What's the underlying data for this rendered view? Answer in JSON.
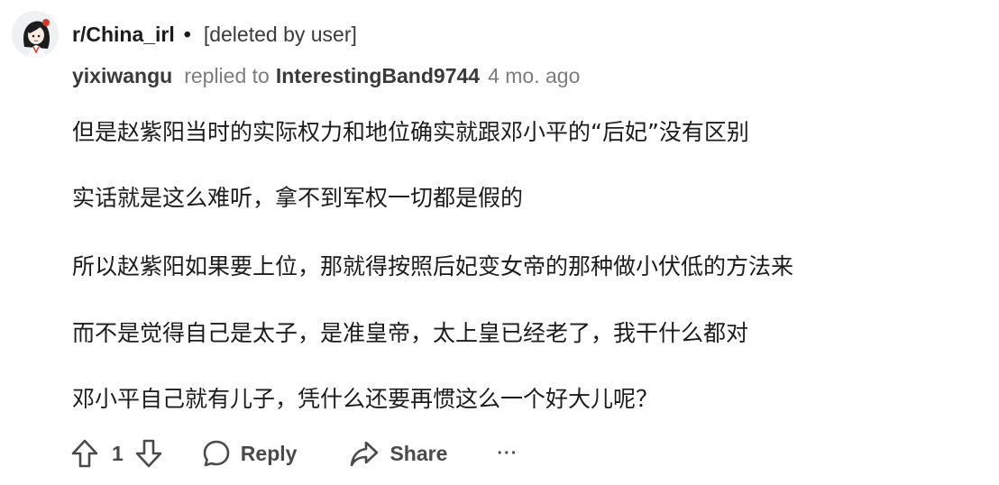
{
  "post": {
    "subreddit": "r/China_irl",
    "separator": "•",
    "deleted_label": "[deleted by user]"
  },
  "comment": {
    "author": "yixiwangu",
    "replied_to_label": "replied to",
    "replied_to_user": "InterestingBand9744",
    "age": "4 mo. ago",
    "lines": [
      "但是赵紫阳当时的实际权力和地位确实就跟邓小平的“后妃”没有区别",
      "实话就是这么难听，拿不到军权一切都是假的",
      "所以赵紫阳如果要上位，那就得按照后妃变女帝的那种做小伏低的方法来",
      "而不是觉得自己是太子，是准皇帝，太上皇已经老了，我干什么都对",
      "邓小平自己就有儿子，凭什么还要再惯这么一个好大儿呢？"
    ]
  },
  "actions": {
    "upvote_icon": "arrow-up-icon",
    "score": "1",
    "downvote_icon": "arrow-down-icon",
    "reply_icon": "speech-bubble-icon",
    "reply_label": "Reply",
    "share_icon": "share-arrow-icon",
    "share_label": "Share",
    "more_label": "···"
  },
  "colors": {
    "text": "#1c1c1c",
    "meta_gray": "#7c7c7c",
    "action_gray": "#4a4a4a"
  }
}
